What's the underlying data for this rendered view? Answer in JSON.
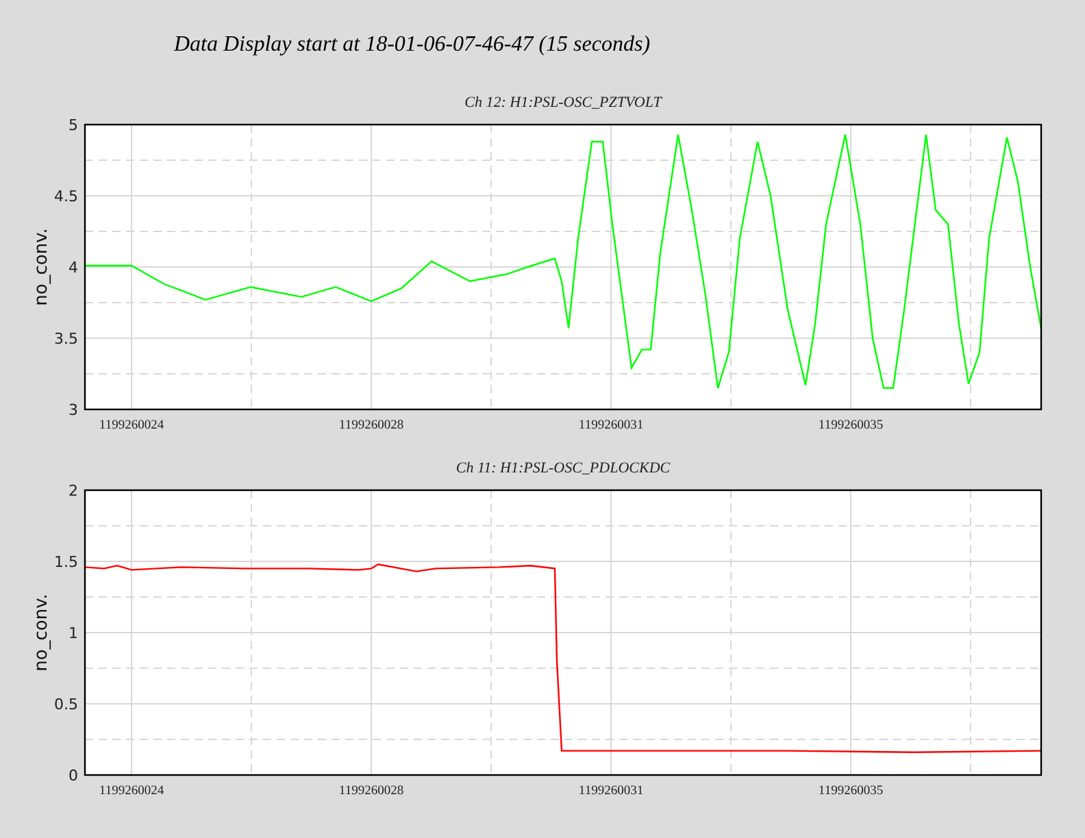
{
  "title": "Data Display start at 18-01-06-07-46-47 (15 seconds)",
  "charts": [
    {
      "chart_data": {
        "type": "line",
        "title": "Ch 12: H1:PSL-OSC_PZTVOLT",
        "ylabel": "no_conv.",
        "grid": true,
        "xlim": [
          1199260023.77,
          1199260037.73
        ],
        "ylim": [
          3,
          5
        ],
        "xticks": [
          {
            "value": 1199260024.45,
            "label": "1199260024"
          },
          {
            "value": 1199260027.95,
            "label": "1199260028"
          },
          {
            "value": 1199260031.45,
            "label": "1199260031"
          },
          {
            "value": 1199260034.95,
            "label": "1199260035"
          }
        ],
        "yticks": [
          {
            "value": 3,
            "label": "3"
          },
          {
            "value": 3.5,
            "label": "3.5"
          },
          {
            "value": 4,
            "label": "4"
          },
          {
            "value": 4.5,
            "label": "4.5"
          },
          {
            "value": 5,
            "label": "5"
          }
        ],
        "x": [
          1199260023.77,
          1199260024.45,
          1199260024.93,
          1199260025.53,
          1199260026.19,
          1199260026.93,
          1199260027.43,
          1199260027.95,
          1199260028.39,
          1199260028.83,
          1199260029.39,
          1199260029.93,
          1199260030.23,
          1199260030.63,
          1199260030.73,
          1199260030.83,
          1199260030.97,
          1199260031.17,
          1199260031.33,
          1199260031.47,
          1199260031.75,
          1199260031.9,
          1199260032.03,
          1199260032.17,
          1199260032.43,
          1199260032.63,
          1199260032.83,
          1199260033.01,
          1199260033.17,
          1199260033.33,
          1199260033.59,
          1199260033.78,
          1199260034.03,
          1199260034.29,
          1199260034.43,
          1199260034.59,
          1199260034.87,
          1199260035.09,
          1199260035.27,
          1199260035.43,
          1199260035.57,
          1199260035.73,
          1199260036.05,
          1199260036.19,
          1199260036.37,
          1199260036.53,
          1199260036.67,
          1199260036.83,
          1199260036.97,
          1199260037.23,
          1199260037.39,
          1199260037.57,
          1199260037.73
        ],
        "series": [
          {
            "color": "#00ff00",
            "values": [
              4.01,
              4.01,
              3.88,
              3.77,
              3.86,
              3.79,
              3.86,
              3.76,
              3.85,
              4.04,
              3.9,
              3.95,
              4.0,
              4.06,
              3.9,
              3.57,
              4.2,
              4.88,
              4.88,
              4.3,
              3.29,
              3.42,
              3.42,
              4.1,
              4.93,
              4.4,
              3.8,
              3.15,
              3.4,
              4.2,
              4.88,
              4.5,
              3.7,
              3.17,
              3.6,
              4.3,
              4.93,
              4.3,
              3.5,
              3.15,
              3.15,
              3.7,
              4.93,
              4.4,
              4.3,
              3.6,
              3.18,
              3.4,
              4.2,
              4.91,
              4.6,
              4.0,
              3.57
            ]
          }
        ]
      }
    },
    {
      "chart_data": {
        "type": "line",
        "title": "Ch 11: H1:PSL-OSC_PDLOCKDC",
        "ylabel": "no_conv.",
        "grid": true,
        "xlim": [
          1199260023.77,
          1199260037.73
        ],
        "ylim": [
          0,
          2
        ],
        "xticks": [
          {
            "value": 1199260024.45,
            "label": "1199260024"
          },
          {
            "value": 1199260027.95,
            "label": "1199260028"
          },
          {
            "value": 1199260031.45,
            "label": "1199260031"
          },
          {
            "value": 1199260034.95,
            "label": "1199260035"
          }
        ],
        "yticks": [
          {
            "value": 0,
            "label": "0"
          },
          {
            "value": 0.5,
            "label": "0.5"
          },
          {
            "value": 1,
            "label": "1"
          },
          {
            "value": 1.5,
            "label": "1.5"
          },
          {
            "value": 2,
            "label": "2"
          }
        ],
        "x": [
          1199260023.77,
          1199260024.05,
          1199260024.24,
          1199260024.45,
          1199260025.17,
          1199260026.1,
          1199260027.03,
          1199260027.77,
          1199260027.95,
          1199260028.05,
          1199260028.61,
          1199260028.89,
          1199260029.82,
          1199260030.28,
          1199260030.63,
          1199260030.66,
          1199260030.73,
          1199260032.15,
          1199260034.01,
          1199260035.87,
          1199260037.73
        ],
        "series": [
          {
            "color": "#ff0000",
            "values": [
              1.46,
              1.45,
              1.47,
              1.44,
              1.46,
              1.45,
              1.45,
              1.44,
              1.45,
              1.48,
              1.43,
              1.45,
              1.46,
              1.47,
              1.45,
              0.8,
              0.17,
              0.17,
              0.17,
              0.16,
              0.17
            ]
          }
        ]
      }
    }
  ]
}
